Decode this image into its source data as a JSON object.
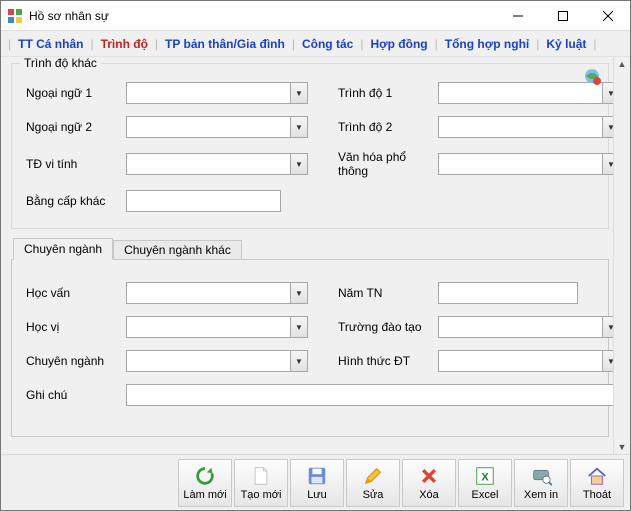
{
  "window": {
    "title": "Hồ sơ nhân sự"
  },
  "main_tabs": {
    "items": [
      {
        "label": "TT Cá nhân"
      },
      {
        "label": "Trình độ"
      },
      {
        "label": "TP bản thân/Gia đình"
      },
      {
        "label": "Công tác"
      },
      {
        "label": "Hợp đồng"
      },
      {
        "label": "Tổng hợp nghỉ"
      },
      {
        "label": "Kỷ luật"
      }
    ],
    "active_index": 1
  },
  "group": {
    "title": "Trình độ khác",
    "fields": {
      "foreign_lang_1": {
        "label": "Ngoại ngữ 1",
        "value": ""
      },
      "level_1": {
        "label": "Trình độ 1",
        "value": ""
      },
      "foreign_lang_2": {
        "label": "Ngoại ngữ 2",
        "value": ""
      },
      "level_2": {
        "label": "Trình độ 2",
        "value": ""
      },
      "it_level": {
        "label": "TĐ vi tính",
        "value": ""
      },
      "general_culture": {
        "label": "Văn hóa phổ thông",
        "value": ""
      },
      "other_degree": {
        "label": "Bằng cấp khác",
        "value": ""
      }
    }
  },
  "sub_tabs": {
    "items": [
      {
        "label": "Chuyên ngành"
      },
      {
        "label": "Chuyên ngành khác"
      }
    ],
    "active_index": 0,
    "fields": {
      "education": {
        "label": "Học vấn",
        "value": ""
      },
      "grad_year": {
        "label": "Năm TN",
        "value": ""
      },
      "degree": {
        "label": "Học vị",
        "value": ""
      },
      "school": {
        "label": "Trường đào tạo",
        "value": ""
      },
      "major": {
        "label": "Chuyên ngành",
        "value": ""
      },
      "training_form": {
        "label": "Hình thức ĐT",
        "value": ""
      },
      "note": {
        "label": "Ghi chú",
        "value": ""
      }
    }
  },
  "toolbar": {
    "refresh": "Làm mới",
    "new": "Tạo mới",
    "save": "Lưu",
    "edit": "Sửa",
    "delete": "Xóa",
    "excel": "Excel",
    "preview": "Xem in",
    "exit": "Thoát"
  }
}
